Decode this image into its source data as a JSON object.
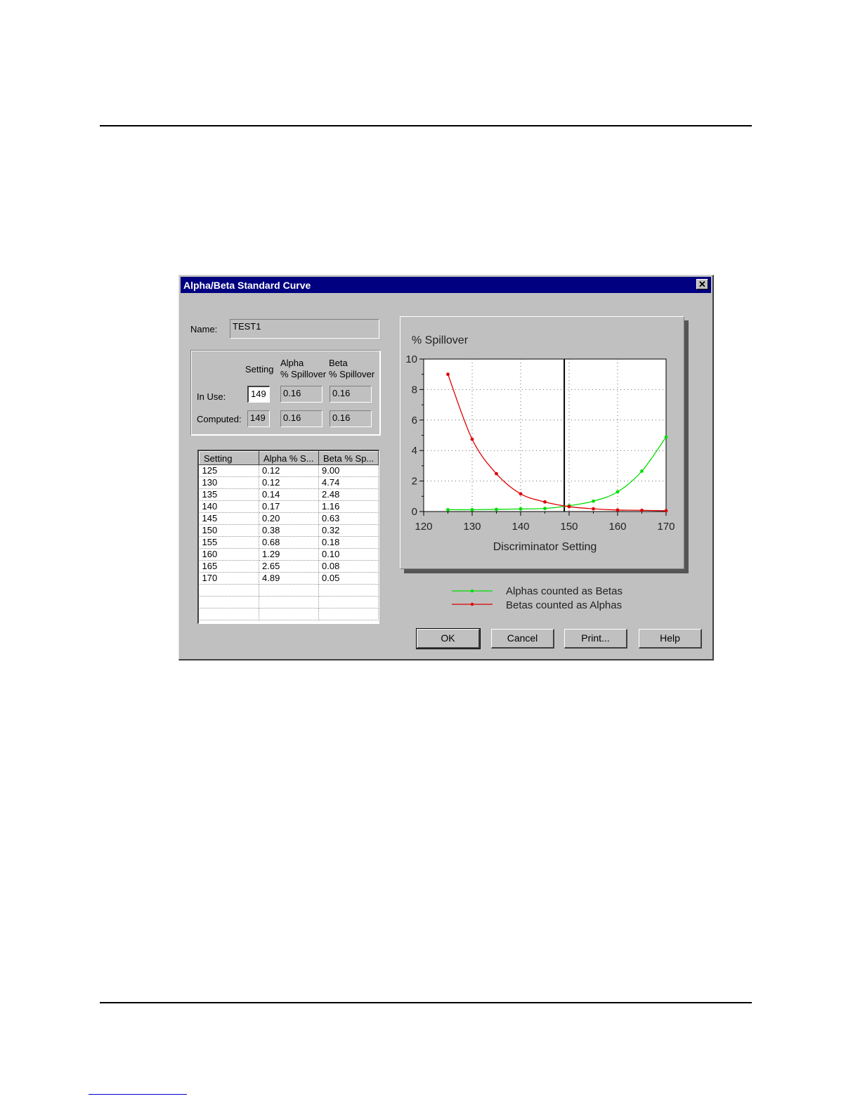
{
  "window": {
    "title": "Alpha/Beta Standard Curve",
    "close_glyph": "✕"
  },
  "name": {
    "label": "Name:",
    "value": "TEST1"
  },
  "settings": {
    "col_setting": "Setting",
    "col_alpha": [
      "Alpha",
      "% Spillover"
    ],
    "col_beta": [
      "Beta",
      "% Spillover"
    ],
    "in_use": {
      "label": "In Use:",
      "setting": "149",
      "alpha": "0.16",
      "beta": "0.16"
    },
    "computed": {
      "label": "Computed:",
      "setting": "149",
      "alpha": "0.16",
      "beta": "0.16"
    }
  },
  "table": {
    "headers": [
      "Setting",
      "Alpha % S...",
      "Beta % Sp..."
    ],
    "rows": [
      [
        "125",
        "0.12",
        "9.00"
      ],
      [
        "130",
        "0.12",
        "4.74"
      ],
      [
        "135",
        "0.14",
        "2.48"
      ],
      [
        "140",
        "0.17",
        "1.16"
      ],
      [
        "145",
        "0.20",
        "0.63"
      ],
      [
        "150",
        "0.38",
        "0.32"
      ],
      [
        "155",
        "0.68",
        "0.18"
      ],
      [
        "160",
        "1.29",
        "0.10"
      ],
      [
        "165",
        "2.65",
        "0.08"
      ],
      [
        "170",
        "4.89",
        "0.05"
      ]
    ],
    "empty_rows": 3
  },
  "chart_data": {
    "type": "line",
    "title": "% Spillover",
    "xlabel": "Discriminator Setting",
    "ylabel": "",
    "xlim": [
      120,
      170
    ],
    "ylim": [
      0,
      10
    ],
    "xticks": [
      "120",
      "130",
      "140",
      "150",
      "160",
      "170"
    ],
    "yticks": [
      "0",
      "2",
      "4",
      "6",
      "8",
      "10"
    ],
    "x": [
      125,
      130,
      135,
      140,
      145,
      150,
      155,
      160,
      165,
      170
    ],
    "series": [
      {
        "name": "Alphas counted as Betas",
        "color": "#00dd00",
        "values": [
          0.12,
          0.12,
          0.14,
          0.17,
          0.2,
          0.38,
          0.68,
          1.29,
          2.65,
          4.89
        ]
      },
      {
        "name": "Betas counted as Alphas",
        "color": "#dd0000",
        "values": [
          9.0,
          4.74,
          2.48,
          1.16,
          0.63,
          0.32,
          0.18,
          0.1,
          0.08,
          0.05
        ]
      }
    ],
    "marker_line_x": 149,
    "grid": true,
    "legend": "below"
  },
  "buttons": {
    "ok": "OK",
    "cancel": "Cancel",
    "print": "Print...",
    "help": "Help"
  }
}
